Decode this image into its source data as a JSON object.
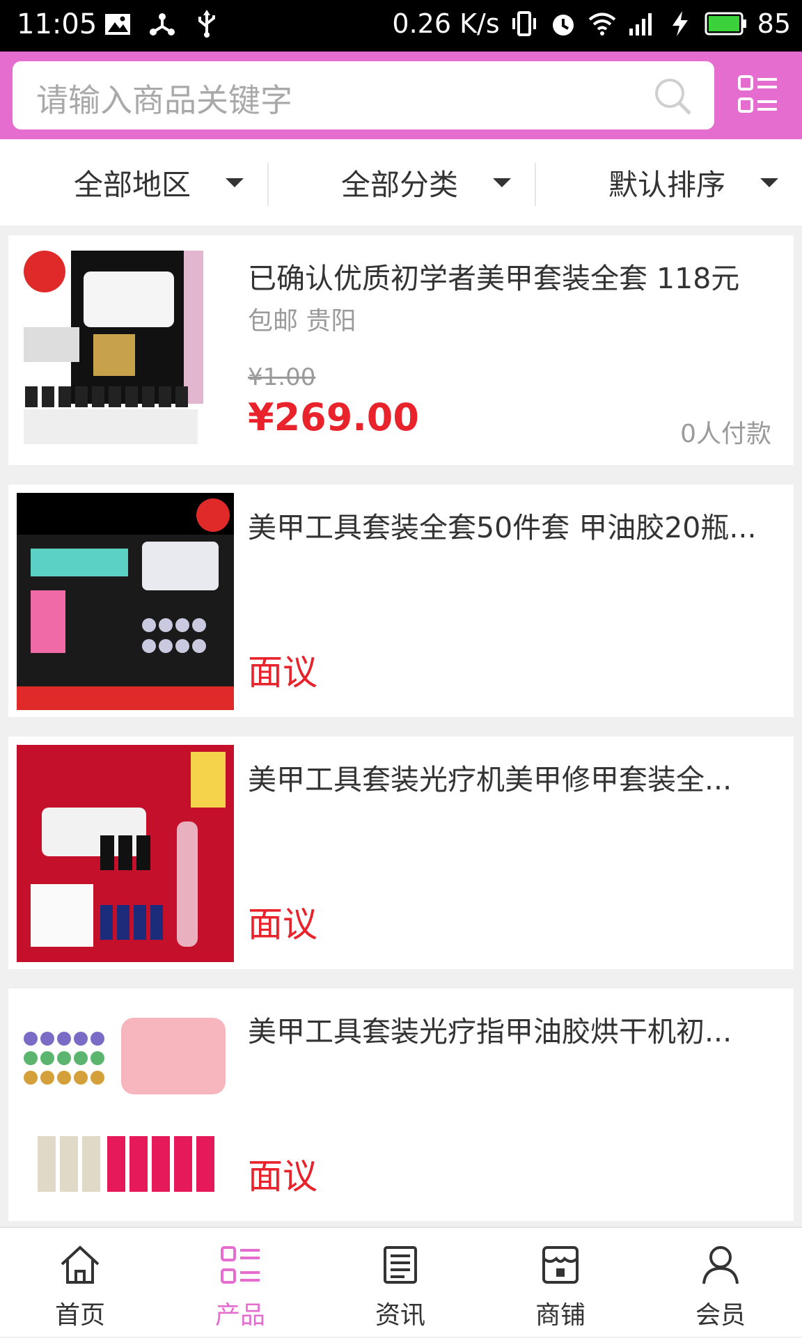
{
  "status_bar": {
    "time": "11:05",
    "speed": "0.26 K/s",
    "battery": "85"
  },
  "search": {
    "placeholder": "请输入商品关键字"
  },
  "filters": [
    {
      "label": "全部地区"
    },
    {
      "label": "全部分类"
    },
    {
      "label": "默认排序"
    }
  ],
  "products": [
    {
      "title": "已确认优质初学者美甲套装全套 118元",
      "meta": "包邮 贵阳",
      "old_price": "¥1.00",
      "price": "¥269.00",
      "paid": "0人付款"
    },
    {
      "title": "美甲工具套装全套50件套 甲油胶20瓶...",
      "price_text": "面议"
    },
    {
      "title": "美甲工具套装光疗机美甲修甲套装全...",
      "price_text": "面议"
    },
    {
      "title": "美甲工具套装光疗指甲油胶烘干机初...",
      "price_text": "面议"
    }
  ],
  "tabbar": [
    {
      "label": "首页",
      "icon": "home-icon"
    },
    {
      "label": "产品",
      "icon": "grid-list-icon",
      "active": true
    },
    {
      "label": "资讯",
      "icon": "news-icon"
    },
    {
      "label": "商铺",
      "icon": "shop-icon"
    },
    {
      "label": "会员",
      "icon": "user-icon"
    }
  ],
  "colors": {
    "accent": "#e56dd0",
    "price": "#e8232c"
  }
}
